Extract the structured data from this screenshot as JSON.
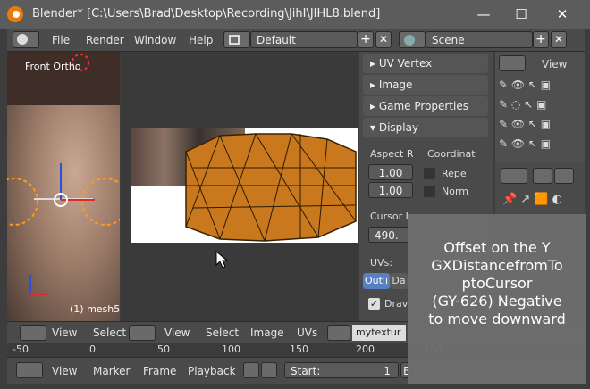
{
  "window": {
    "title": "Blender* [C:\\Users\\Brad\\Desktop\\Recording\\JihI\\JIHL8.blend]",
    "minimize": "—",
    "maximize": "☐",
    "close": "✕"
  },
  "menubar": {
    "items": [
      "File",
      "Render",
      "Window",
      "Help"
    ],
    "layout": "Default",
    "scene": "Scene"
  },
  "viewport3d": {
    "label": "Front Ortho",
    "object_info": "(1) mesh5"
  },
  "props": {
    "panels": [
      "UV Vertex",
      "Image",
      "Game Properties",
      "Display"
    ],
    "aspect_label": "Aspect R",
    "coord_label": "Coordinat",
    "aspect_x": "1.00",
    "aspect_y": "1.00",
    "repeat_label": "Repe",
    "normalized_label": "Norm",
    "cursor_label": "Cursor L",
    "cursor_value": "490.",
    "uvs_label": "UVs:",
    "outline_label": "Outli",
    "dashed_label": "Da",
    "draw_label": "Drav"
  },
  "outliner": {
    "view_label": "View"
  },
  "uv_header": {
    "view": "View",
    "select": "Select",
    "image": "Image",
    "uvs": "UVs",
    "texture_name": "mytextur"
  },
  "left_header": {
    "view": "View",
    "select": "Select"
  },
  "ruler": {
    "ticks": [
      "-50",
      "0",
      "50",
      "100",
      "150",
      "200",
      "250"
    ]
  },
  "timeline": {
    "view": "View",
    "marker": "Marker",
    "frame": "Frame",
    "playback": "Playback",
    "start_label": "Start:",
    "start_value": "1",
    "end_label": "E"
  },
  "overlay": {
    "text": "Offset on the Y\nGXDistancefromTo\nptoCursor\n(GY-626) Negative\nto move downward"
  }
}
